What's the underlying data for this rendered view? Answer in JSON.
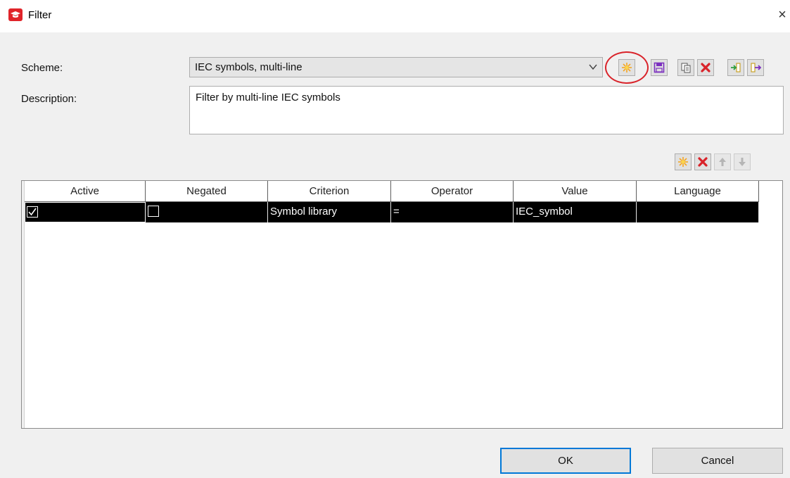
{
  "window": {
    "title": "Filter",
    "close_glyph": "×",
    "icon": "graduation-cap-icon"
  },
  "form": {
    "scheme_label": "Scheme:",
    "scheme_value": "IEC symbols, multi-line",
    "description_label": "Description:",
    "description_value": "Filter by multi-line IEC symbols"
  },
  "scheme_toolbar": [
    "new-icon",
    "save-icon",
    "copy-icon",
    "delete-icon",
    "import-icon",
    "export-icon"
  ],
  "grid_toolbar": [
    "new-icon",
    "delete-icon",
    "move-up-icon",
    "move-down-icon"
  ],
  "grid": {
    "columns": [
      "Active",
      "Negated",
      "Criterion",
      "Operator",
      "Value",
      "Language"
    ],
    "rows": [
      {
        "active": true,
        "negated": false,
        "criterion": "Symbol library",
        "operator": "=",
        "value": "IEC_symbol",
        "language": ""
      }
    ]
  },
  "buttons": {
    "ok": "OK",
    "cancel": "Cancel"
  },
  "colors": {
    "accent": "#0078d7",
    "callout": "#d9232a",
    "new_icon": "#f5a623",
    "delete_icon": "#d9232a",
    "save_icon": "#8a2be2"
  }
}
